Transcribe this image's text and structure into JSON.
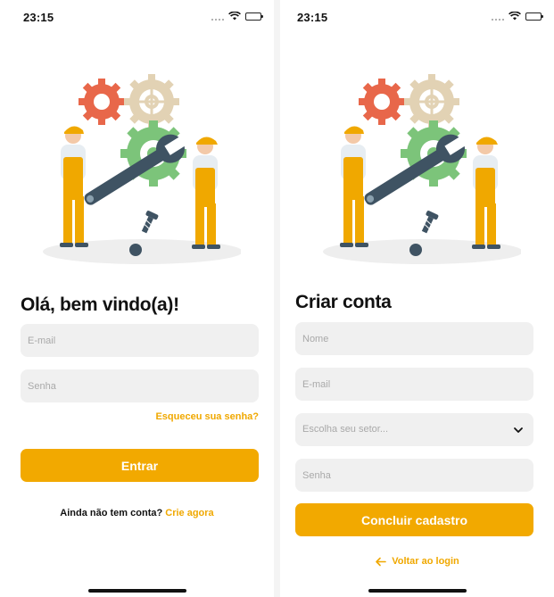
{
  "status_bar": {
    "time": "23:15"
  },
  "login": {
    "title": "Olá, bem vindo(a)!",
    "email_placeholder": "E-mail",
    "password_placeholder": "Senha",
    "forgot_password": "Esqueceu sua senha?",
    "submit_label": "Entrar",
    "no_account_text": "Ainda não tem conta?",
    "create_now_link": "Crie agora"
  },
  "signup": {
    "title": "Criar conta",
    "name_placeholder": "Nome",
    "email_placeholder": "E-mail",
    "sector_placeholder": "Escolha seu setor...",
    "password_placeholder": "Senha",
    "submit_label": "Concluir cadastro",
    "back_to_login": "Voltar ao login"
  },
  "icons": {
    "wifi": "wifi-icon",
    "battery": "battery-icon",
    "chevron": "chevron-down-icon",
    "back_arrow": "arrow-left-icon"
  },
  "colors": {
    "accent": "#f2a900",
    "field_bg": "#f0f0f0",
    "placeholder": "#a9a9a9",
    "gear_red": "#e8674a",
    "gear_beige": "#e2d2b4",
    "gear_green": "#7cc47a",
    "wrench": "#3f5363",
    "worker_yellow": "#f0a800"
  }
}
